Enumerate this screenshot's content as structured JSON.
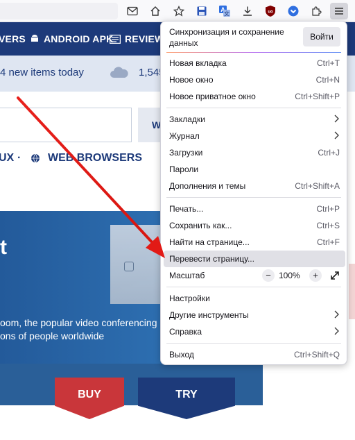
{
  "toolbar": {
    "icons": [
      "mail-icon",
      "home-icon",
      "star-bookmark-icon",
      "save-page-icon",
      "translate-icon",
      "downloads-icon",
      "ublock-icon",
      "pocket-icon",
      "extensions-icon",
      "menu-icon"
    ]
  },
  "site": {
    "nav": [
      "VERS",
      "ANDROID APK",
      "REVIEWS"
    ],
    "notice_text": "4 new items today",
    "notice_count": "1,545",
    "search_btn_partial": "W",
    "categories": [
      "UX",
      "·",
      "WEB BROWSERS"
    ],
    "hero_big": "t",
    "hero_line1": "oom, the popular video conferencing",
    "hero_line2": "ons of people worldwide",
    "buy_label": "BUY",
    "try_label": "TRY"
  },
  "menu": {
    "sync_text": "Синхронизация и сохранение данных",
    "signin_label": "Войти",
    "items": [
      {
        "label": "Новая вкладка",
        "shortcut": "Ctrl+T"
      },
      {
        "label": "Новое окно",
        "shortcut": "Ctrl+N"
      },
      {
        "label": "Новое приватное окно",
        "shortcut": "Ctrl+Shift+P"
      },
      {
        "label": "Закладки",
        "shortcut": ""
      },
      {
        "label": "Журнал",
        "shortcut": ""
      },
      {
        "label": "Загрузки",
        "shortcut": "Ctrl+J"
      },
      {
        "label": "Пароли",
        "shortcut": ""
      },
      {
        "label": "Дополнения и темы",
        "shortcut": "Ctrl+Shift+A"
      },
      {
        "label": "Печать...",
        "shortcut": "Ctrl+P"
      },
      {
        "label": "Сохранить как...",
        "shortcut": "Ctrl+S"
      },
      {
        "label": "Найти на странице...",
        "shortcut": "Ctrl+F"
      },
      {
        "label": "Перевести страницу...",
        "shortcut": ""
      },
      {
        "label": "Масштаб",
        "shortcut": ""
      },
      {
        "label": "Настройки",
        "shortcut": ""
      },
      {
        "label": "Другие инструменты",
        "shortcut": ""
      },
      {
        "label": "Справка",
        "shortcut": ""
      },
      {
        "label": "Выход",
        "shortcut": "Ctrl+Shift+Q"
      }
    ],
    "zoom": {
      "minus": "−",
      "value": "100%",
      "plus": "+"
    }
  },
  "colors": {
    "site_nav": "#1d3a7a",
    "buy": "#c9363a",
    "arrow": "#e8201c",
    "highlight": "#e0e0e6"
  }
}
